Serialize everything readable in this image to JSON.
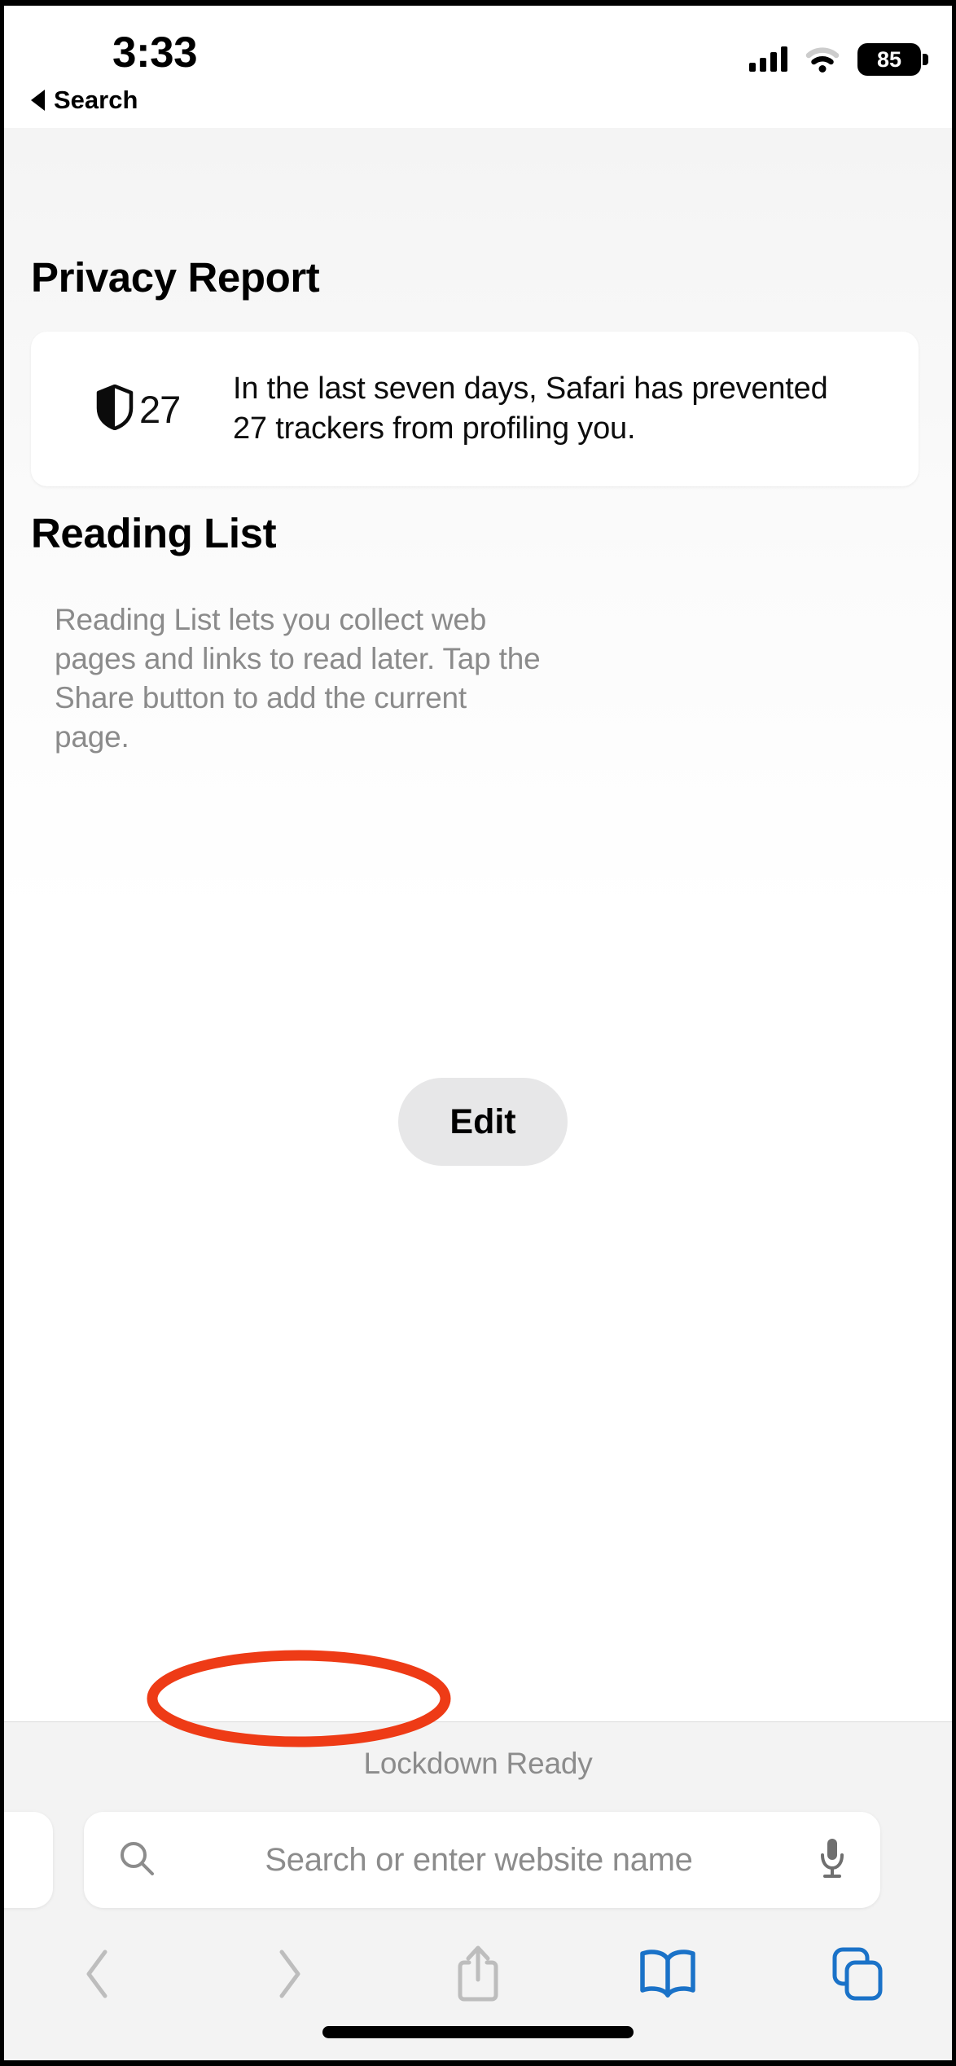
{
  "status_bar": {
    "time": "3:33",
    "battery_percent": "85",
    "signal_icon": "cellular-signal-icon",
    "wifi_icon": "wifi-icon",
    "battery_icon": "battery-icon"
  },
  "back_link": {
    "label": "Search",
    "icon": "back-triangle-icon"
  },
  "privacy_report": {
    "title": "Privacy Report",
    "shield_icon": "shield-icon",
    "tracker_count": "27",
    "description": "In the last seven days, Safari has prevented 27 trackers from profiling you."
  },
  "reading_list": {
    "title": "Reading List",
    "description": "Reading List lets you collect web pages and links to read later. Tap the Share button to add the current page.",
    "edit_label": "Edit"
  },
  "bottom_bar": {
    "status_text": "Lockdown Ready",
    "search": {
      "placeholder": "Search or enter website name",
      "value": "",
      "search_icon": "search-icon",
      "mic_icon": "microphone-icon"
    },
    "toolbar": {
      "back_icon": "chevron-left-icon",
      "forward_icon": "chevron-right-icon",
      "share_icon": "share-icon",
      "bookmarks_icon": "book-icon",
      "tabs_icon": "tabs-icon"
    }
  },
  "annotation": {
    "shape": "ellipse-highlight",
    "color": "#EE3B16",
    "target": "Lockdown Ready"
  },
  "colors": {
    "accent_blue": "#1a72c8",
    "disabled_gray": "#bbbbbb",
    "secondary_text": "#8c8c8c",
    "toolbar_bg": "#f3f3f3",
    "annotation_red": "#EE3B16"
  }
}
